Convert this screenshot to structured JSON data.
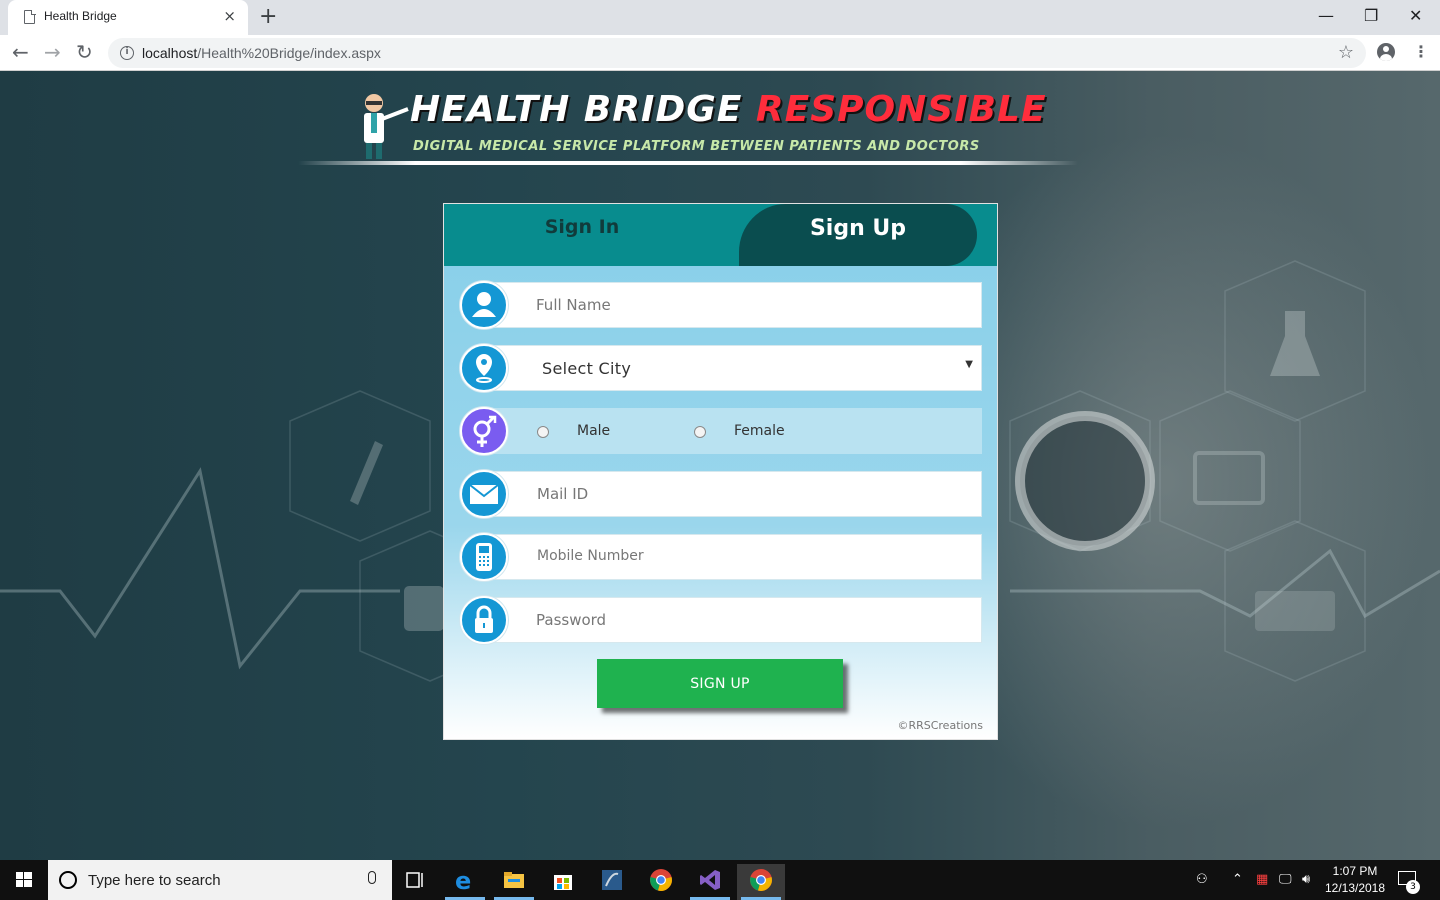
{
  "browser": {
    "tab_title": "Health Bridge",
    "tab_close": "×",
    "new_tab": "+",
    "url_host": "localhost",
    "url_path": "/Health%20Bridge/index.aspx",
    "window_minimize": "—",
    "window_restore": "❐",
    "window_close": "✕"
  },
  "logo": {
    "title_white": "HEALTH BRIDGE",
    "title_red": "RESPONSIBLE",
    "subtitle": "DIGITAL MEDICAL SERVICE PLATFORM BETWEEN PATIENTS AND DOCTORS"
  },
  "form": {
    "tab_signin": "Sign In",
    "tab_signup": "Sign Up",
    "fields": {
      "full_name_placeholder": "Full Name",
      "city_selected": "Select City",
      "gender_male": "Male",
      "gender_female": "Female",
      "mail_placeholder": "Mail ID",
      "mobile_placeholder": "Mobile Number",
      "password_placeholder": "Password"
    },
    "submit_label": "SIGN UP",
    "copyright": "©RRSCreations"
  },
  "colors": {
    "tab_bar": "#088c8e",
    "tab_active": "#0a4d4f",
    "icon_blue": "#1497d4",
    "icon_gender": "#7a5cf0",
    "button_green": "#1fb24f",
    "logo_red": "#ff2d3c"
  },
  "taskbar": {
    "search_placeholder": "Type here to search",
    "time": "1:07 PM",
    "date": "12/13/2018",
    "notification_count": "3",
    "apps": [
      "task-view",
      "edge",
      "file-explorer",
      "store",
      "sql-server",
      "chrome",
      "visual-studio",
      "chrome-active"
    ]
  }
}
